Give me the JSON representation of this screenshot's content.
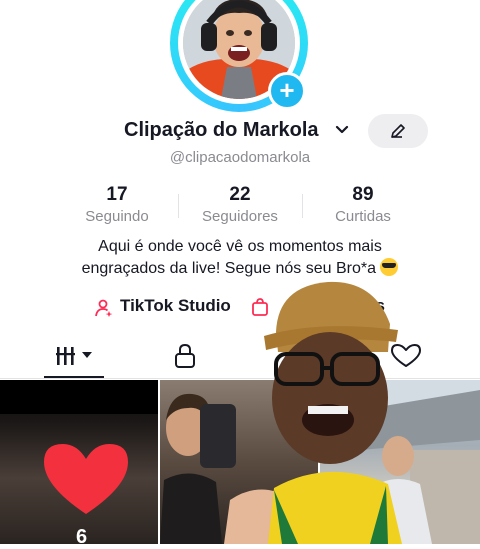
{
  "profile": {
    "display_name": "Clipação do Markola",
    "username": "@clipacaodomarkola",
    "avatar_icon": "avatar-photo",
    "add_icon": "plus-icon"
  },
  "stats": [
    {
      "value": "17",
      "label": "Seguindo"
    },
    {
      "value": "22",
      "label": "Seguidores"
    },
    {
      "value": "89",
      "label": "Curtidas"
    }
  ],
  "bio": {
    "line1": "Aqui é onde você vê os momentos mais",
    "line2": "engraçados da live! Segue nós seu Bro*a"
  },
  "actions": {
    "studio_label": "TikTok Studio",
    "orders_label_partial": "idos"
  },
  "tabs": [
    {
      "icon": "grid-videos-icon",
      "active": true
    },
    {
      "icon": "lock-icon",
      "active": false
    },
    {
      "icon": "heart-icon",
      "active": false
    }
  ],
  "videos": [
    {
      "views": "6"
    },
    {
      "views": ""
    },
    {
      "views": ""
    }
  ],
  "colors": {
    "accent_cyan": "#25f4ee",
    "plus_blue": "#20b8f0",
    "text_primary": "#161823",
    "text_secondary": "#8a8b91",
    "studio_pink": "#fe2c55"
  }
}
